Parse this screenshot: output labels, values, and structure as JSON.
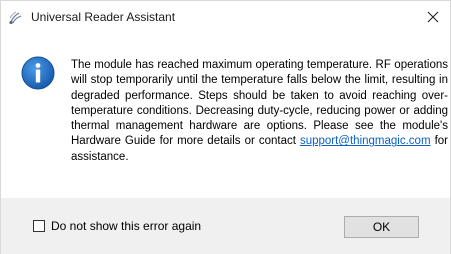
{
  "window": {
    "title": "Universal Reader Assistant",
    "app_icon": "reader-app-icon",
    "close_icon": "close-icon"
  },
  "dialog": {
    "icon": "info-icon",
    "message_text": "The module has reached maximum operating temperature. RF operations will stop temporarily until the temperature falls below the limit, resulting in degraded performance. Steps should be taken to avoid reaching over-temperature conditions. Decreasing duty-cycle, reducing power or adding thermal management hardware are options. Please see the module's Hardware Guide for more details or contact ",
    "support_link": "support@thingmagic.com",
    "message_suffix": " for assistance."
  },
  "footer": {
    "checkbox_label": "Do not show this error again",
    "checkbox_checked": false,
    "ok_label": "OK"
  },
  "colors": {
    "info_blue": "#1d6fc2",
    "link": "#0b61c4",
    "footer_bg": "#f0f0f0",
    "button_bg": "#e1e1e1"
  }
}
